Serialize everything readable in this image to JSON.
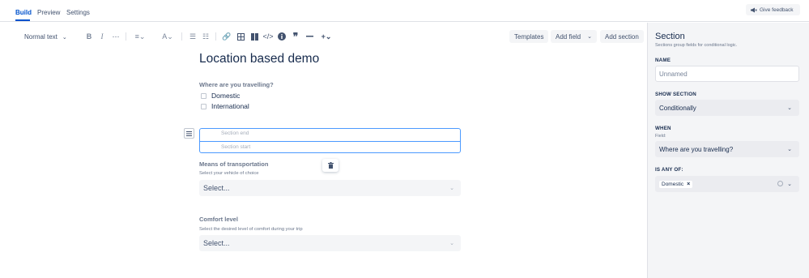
{
  "tabs": [
    {
      "label": "Build"
    },
    {
      "label": "Preview"
    },
    {
      "label": "Settings"
    }
  ],
  "feedback_label": "Give feedback",
  "toolbar": {
    "text_style": "Normal text",
    "templates": "Templates",
    "add_field": "Add field",
    "add_section": "Add section"
  },
  "canvas": {
    "title": "Location based demo",
    "q1": {
      "label": "Where are you travelling?",
      "options": [
        "Domestic",
        "International"
      ]
    },
    "section": {
      "end": "Section end",
      "start": "Section start"
    },
    "q2": {
      "label": "Means of transportation",
      "help": "Select your vehicle of choice",
      "placeholder": "Select..."
    },
    "q3": {
      "label": "Comfort level",
      "help": "Select the desired level of comfort during your trip",
      "placeholder": "Select..."
    }
  },
  "panel": {
    "title": "Section",
    "subtitle": "Sections group fields for conditional logic.",
    "name_label": "NAME",
    "name_placeholder": "Unnamed",
    "show_label": "SHOW SECTION",
    "show_value": "Conditionally",
    "when_label": "WHEN",
    "field_label": "Field:",
    "field_value": "Where are you travelling?",
    "is_any_label": "IS ANY OF:",
    "chip": "Domestic"
  },
  "colors": {
    "accent": "#0052cc",
    "section_border": "#4c9aff",
    "panel_bg": "#f4f5f7"
  }
}
